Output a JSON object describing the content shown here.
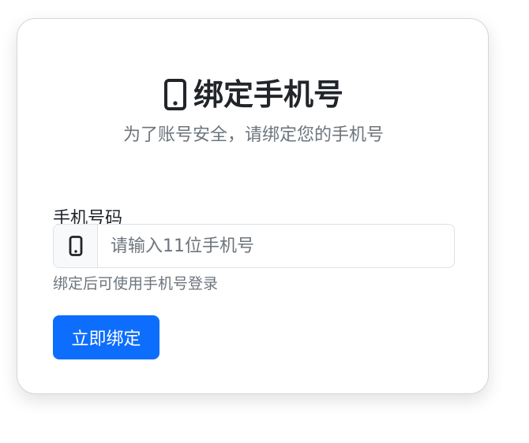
{
  "card": {
    "title": "绑定手机号",
    "title_icon": "phone-icon",
    "subtitle": "为了账号安全，请绑定您的手机号"
  },
  "form": {
    "phone_label": "手机号码",
    "phone_placeholder": "请输入11位手机号",
    "phone_value": "",
    "input_icon": "phone-icon",
    "help_text": "绑定后可使用手机号登录",
    "submit_label": "立即绑定"
  },
  "colors": {
    "primary": "#0d6efd",
    "text": "#212529",
    "muted": "#6c757d",
    "border": "#dee2e6"
  }
}
